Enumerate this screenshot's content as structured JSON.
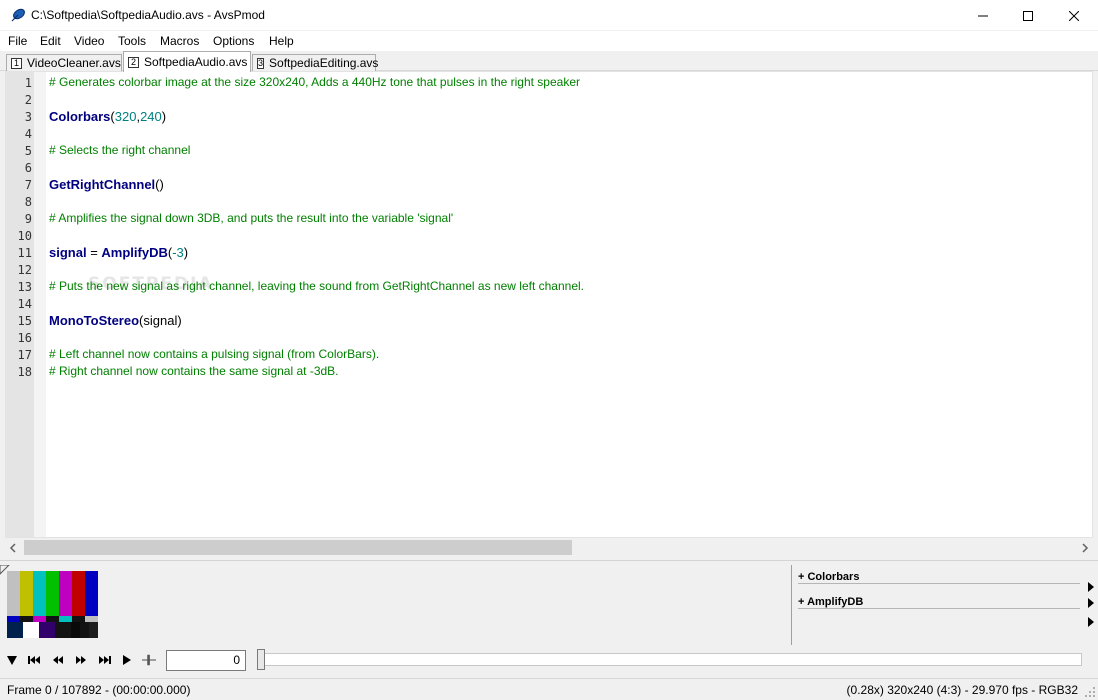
{
  "window": {
    "title": "C:\\Softpedia\\SoftpediaAudio.avs - AvsPmod",
    "app_icon": "avspmod-feather-icon",
    "controls": [
      "minimize-icon",
      "maximize-icon",
      "close-icon"
    ]
  },
  "menu": [
    "File",
    "Edit",
    "Video",
    "Tools",
    "Macros",
    "Options",
    "Help"
  ],
  "tabs": [
    {
      "num": "1",
      "label": "VideoCleaner.avs",
      "active": false
    },
    {
      "num": "2",
      "label": "SoftpediaAudio.avs",
      "active": true
    },
    {
      "num": "3",
      "label": "SoftpediaEditing.avs",
      "active": false
    }
  ],
  "editor": {
    "line_numbers": [
      "1",
      "2",
      "3",
      "4",
      "5",
      "6",
      "7",
      "8",
      "9",
      "10",
      "11",
      "12",
      "13",
      "14",
      "15",
      "16",
      "17",
      "18"
    ],
    "lines": {
      "l1": "# Generates colorbar image at the size 320x240, Adds a 440Hz tone that pulses in the right speaker",
      "l3_fn": "Colorbars",
      "l3_open": "(",
      "l3_a": "320",
      "l3_comma": ",",
      "l3_b": "240",
      "l3_close": ")",
      "l5": "# Selects the right channel",
      "l7_fn": "GetRightChannel",
      "l7_parens": "()",
      "l9": "# Amplifies the signal down 3DB, and puts the result into the variable 'signal'",
      "l11_var": "signal",
      "l11_eq": " = ",
      "l11_fn": "AmplifyDB",
      "l11_open": "(",
      "l11_num": "-3",
      "l11_close": ")",
      "l13": "# Puts the new signal as right channel, leaving the sound from GetRightChannel as new left channel.",
      "l15_fn": "MonoToStereo",
      "l15_args": "(signal)",
      "l17": "# Left channel now contains a pulsing signal (from ColorBars).",
      "l18": "# Right channel now contains the same signal at -3dB."
    },
    "watermark": "SOFTPEDIA"
  },
  "functions_panel": {
    "items": [
      "+ Colorbars",
      "+ AmplifyDB"
    ]
  },
  "playback": {
    "buttons": [
      "toggle-preview-icon",
      "first-frame-icon",
      "prev-frame-icon",
      "next-frame-icon",
      "last-frame-icon",
      "play-icon",
      "crosshair-icon"
    ],
    "frame_value": "0",
    "slider_position": 0
  },
  "status": {
    "left": "Frame 0 / 107892  -  (00:00:00.000)",
    "right": "(0.28x)   320x240 (4:3)  -  29.970 fps  -  RGB32"
  },
  "colors": {
    "comment": "#008000",
    "function": "#000080",
    "number": "#008080",
    "gutter": "#e4e4e4"
  }
}
